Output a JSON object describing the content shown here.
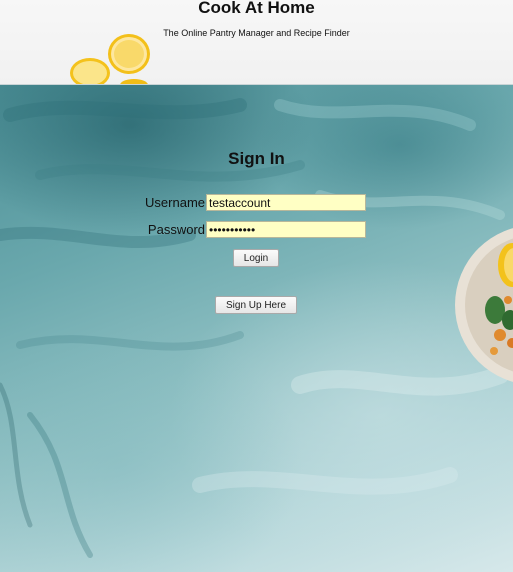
{
  "header": {
    "title": "Cook At Home",
    "subtitle": "The Online Pantry Manager and Recipe Finder"
  },
  "signin": {
    "heading": "Sign In",
    "username_label": "Username",
    "username_value": "testaccount",
    "password_label": "Password",
    "password_value": "testaccount",
    "login_label": "Login",
    "signup_label": "Sign Up Here"
  },
  "colors": {
    "input_bg": "#ffffc4",
    "background_teal": "#6aa8ad",
    "lemon": "#f2c21b"
  }
}
